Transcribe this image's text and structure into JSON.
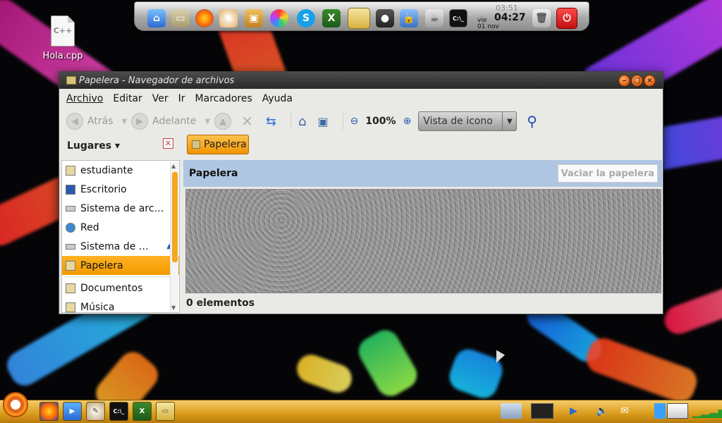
{
  "desktop": {
    "file_label": "Hola.cpp",
    "file_icon_text": "C++"
  },
  "dock": {
    "clock": {
      "ghost_time": "03:51",
      "time": "04:27",
      "day": "vie",
      "date": "01 nov"
    },
    "icons": [
      "home-icon",
      "folder-icon",
      "firefox-icon",
      "paint-icon",
      "package-icon",
      "network-icon",
      "skype-icon",
      "spreadsheet-icon",
      "file-manager-icon",
      "speaker-icon",
      "lock-icon",
      "teapot-icon",
      "terminal-icon",
      "trash-icon",
      "power-icon"
    ]
  },
  "window": {
    "title": "Papelera - Navegador de archivos",
    "menu": [
      "Archivo",
      "Editar",
      "Ver",
      "Ir",
      "Marcadores",
      "Ayuda"
    ],
    "toolbar": {
      "back_label": "Atrás",
      "forward_label": "Adelante",
      "zoom": "100%",
      "view_mode": "Vista de icono"
    },
    "places_label": "Lugares ▾",
    "breadcrumb": "Papelera",
    "sidebar": [
      {
        "label": "estudiante",
        "icon": "home-folder-icon"
      },
      {
        "label": "Escritorio",
        "icon": "desktop-icon"
      },
      {
        "label": "Sistema de arc…",
        "icon": "drive-icon"
      },
      {
        "label": "Red",
        "icon": "network-icon"
      },
      {
        "label": "Sistema de …",
        "icon": "drive-icon",
        "eject": "▲"
      },
      {
        "label": "Papelera",
        "icon": "trash-icon",
        "selected": true
      },
      {
        "label": "Documentos",
        "icon": "documents-icon"
      },
      {
        "label": "Música",
        "icon": "music-icon"
      }
    ],
    "content_header": "Papelera",
    "empty_trash_label": "Vaciar la papelera",
    "status": "0 elementos"
  },
  "panel": {
    "tasks": [
      "firefox-icon",
      "media-player-icon",
      "paint-icon",
      "terminal-icon",
      "spreadsheet-icon",
      "trash-icon"
    ],
    "tray": [
      "network-manager-icon",
      "system-monitor-icon",
      "media-icon",
      "volume-icon",
      "notification-icon",
      "update-icon",
      "display-icon",
      "signal-icon"
    ]
  }
}
